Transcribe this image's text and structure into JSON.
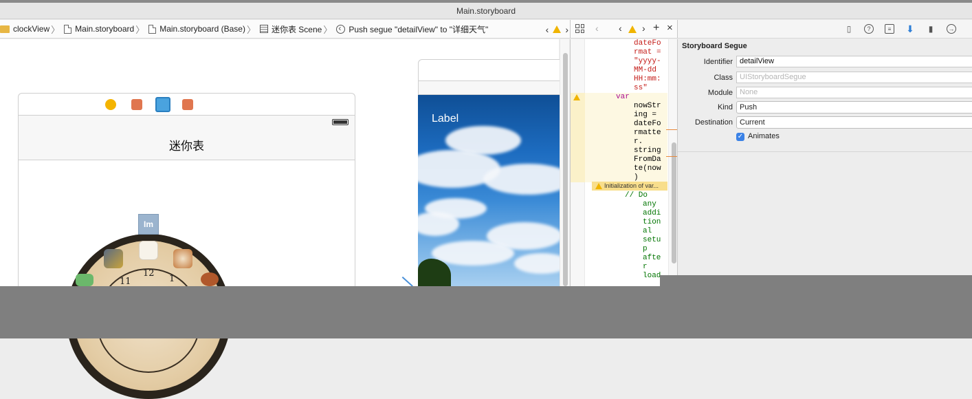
{
  "window": {
    "title": "Main.storyboard"
  },
  "jumpbar": {
    "crumbs": [
      {
        "label": "clockView",
        "icon": "folder-icon"
      },
      {
        "label": "Main.storyboard",
        "icon": "file-icon"
      },
      {
        "label": "Main.storyboard (Base)",
        "icon": "file-icon"
      },
      {
        "label": "迷你表 Scene",
        "icon": "scene-icon"
      },
      {
        "label": "Push segue \"detailView\" to \"详细天气\"",
        "icon": "segue-icon"
      }
    ],
    "nav": {
      "back": "‹",
      "forward": "›"
    }
  },
  "canvas": {
    "scene1": {
      "title": "迷你表",
      "im_icon_label": "Im",
      "clock_numbers": [
        "12",
        "1",
        "11"
      ]
    },
    "scene2": {
      "label": "Label"
    }
  },
  "editor": {
    "toolbar": {
      "back": "‹",
      "prev": "‹",
      "next": "›",
      "add": "+",
      "close": "×"
    },
    "lines_top": [
      "dateFo",
      "rmat =",
      "\"yyyy-",
      "MM-dd",
      "HH:mm:",
      "ss\""
    ],
    "var_keyword": "var",
    "lines_mid": [
      "nowStr",
      "ing =",
      "dateFo",
      "rmatte",
      "r.",
      "string",
      "FromDa",
      "te(now",
      ")"
    ],
    "warning": "Initialization of var...",
    "comment_first": "// Do",
    "comment_lines": [
      "any",
      "addi",
      "tion",
      "al",
      "setu",
      "p",
      "afte",
      "r",
      "load"
    ]
  },
  "inspector": {
    "section": "Storyboard Segue",
    "identifier": {
      "label": "Identifier",
      "value": "detailView"
    },
    "class": {
      "label": "Class",
      "placeholder": "UIStoryboardSegue"
    },
    "module": {
      "label": "Module",
      "placeholder": "None"
    },
    "kind": {
      "label": "Kind",
      "value": "Push"
    },
    "destination": {
      "label": "Destination",
      "value": "Current"
    },
    "animates": {
      "label": "Animates",
      "checked": true
    }
  },
  "colors": {
    "accent": "#3b82e6",
    "warning": "#f0b400",
    "string": "#c41a16",
    "keyword": "#aa0d91",
    "comment": "#007400"
  }
}
